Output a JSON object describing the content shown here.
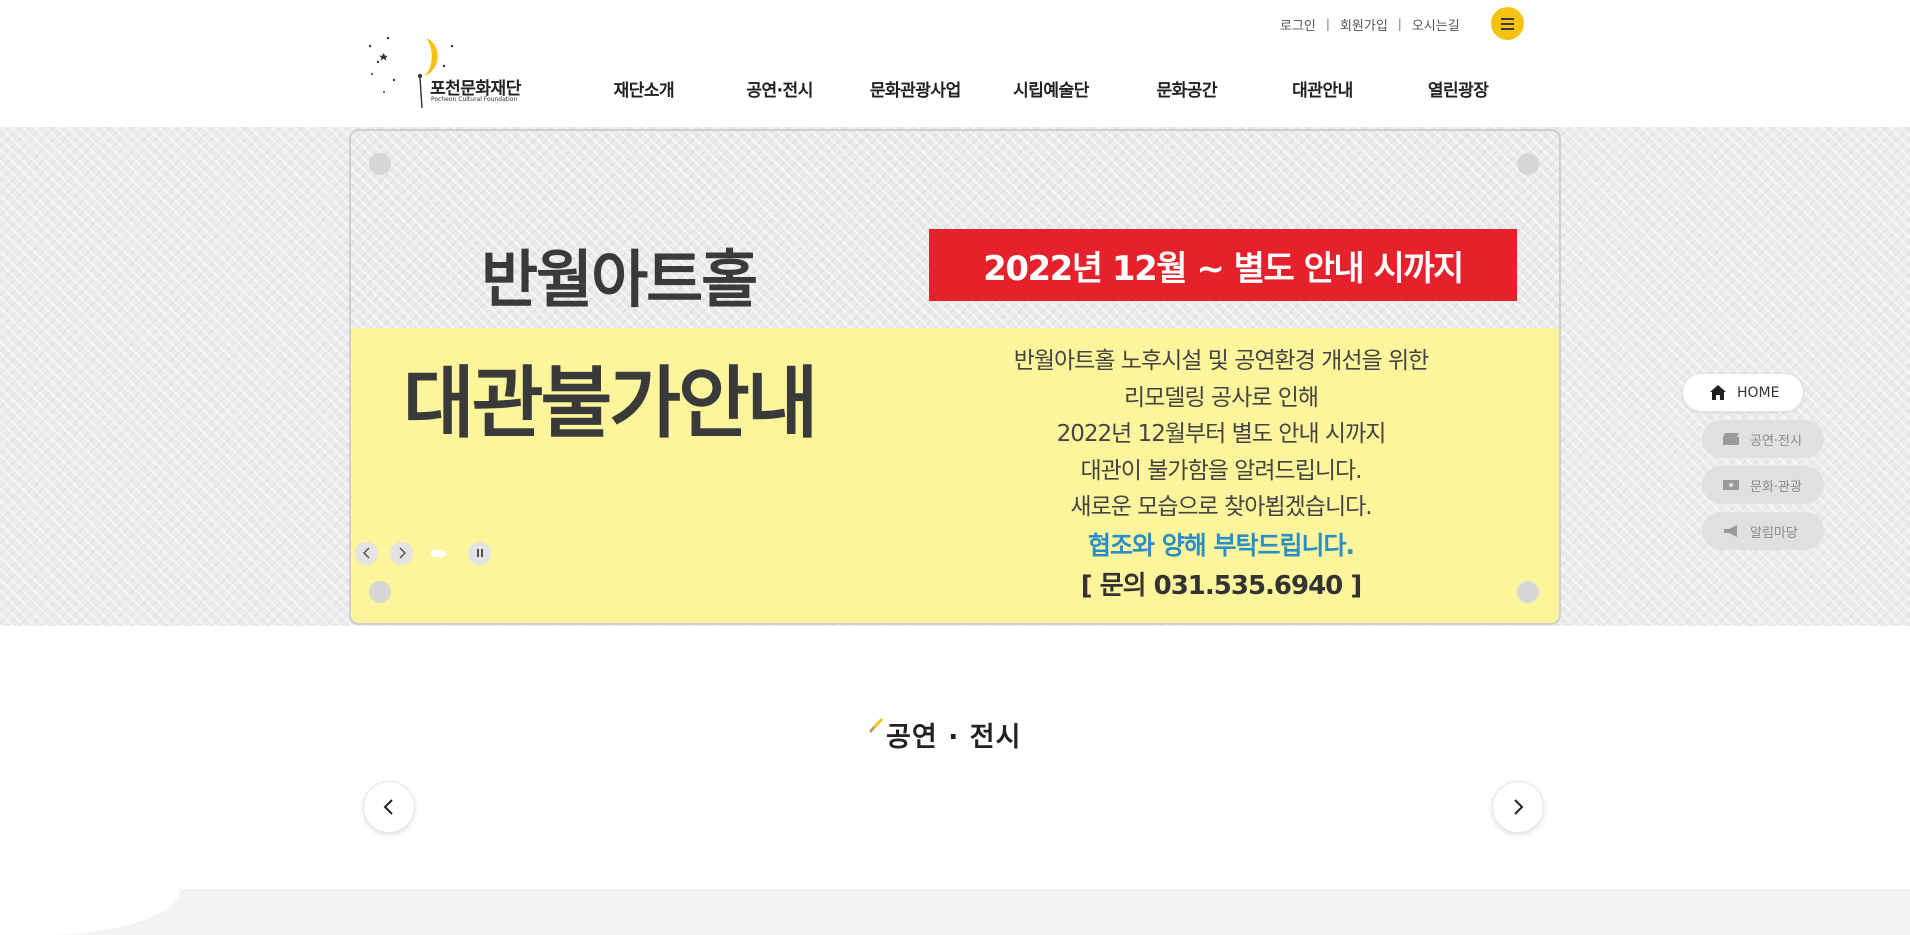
{
  "header": {
    "util_links": [
      "로그인",
      "회원가입",
      "오시는길"
    ],
    "logo": {
      "name": "포천문화재단",
      "sub": "Pocheon Cultural Foundation"
    },
    "gnb": [
      "재단소개",
      "공연·전시",
      "문화관광사업",
      "시립예술단",
      "문화공간",
      "대관안내",
      "열린광장"
    ]
  },
  "banner": {
    "hall_name": "반월아트홀",
    "date_notice": "2022년 12월 ~ 별도 안내 시까지",
    "big_notice": "대관불가안내",
    "lines": [
      "반월아트홀 노후시설 및 공연환경 개선을 위한",
      "리모델링 공사로 인해",
      "2022년 12월부터 별도 안내 시까지",
      "대관이 불가함을 알려드립니다.",
      "새로운 모습으로 찾아뵙겠습니다."
    ],
    "thanks": "협조와 양해 부탁드립니다.",
    "contact": "[ 문의 031.535.6940 ]",
    "colors": {
      "red": "#e5222b",
      "yellow": "#fdf59c",
      "blue": "#2a8fc9"
    }
  },
  "quick_menu": {
    "home": "HOME",
    "items": [
      "공연·전시",
      "문화·관광",
      "알림마당"
    ]
  },
  "section": {
    "title": "공연 · 전시"
  },
  "colors": {
    "accent": "#f6c20f"
  }
}
